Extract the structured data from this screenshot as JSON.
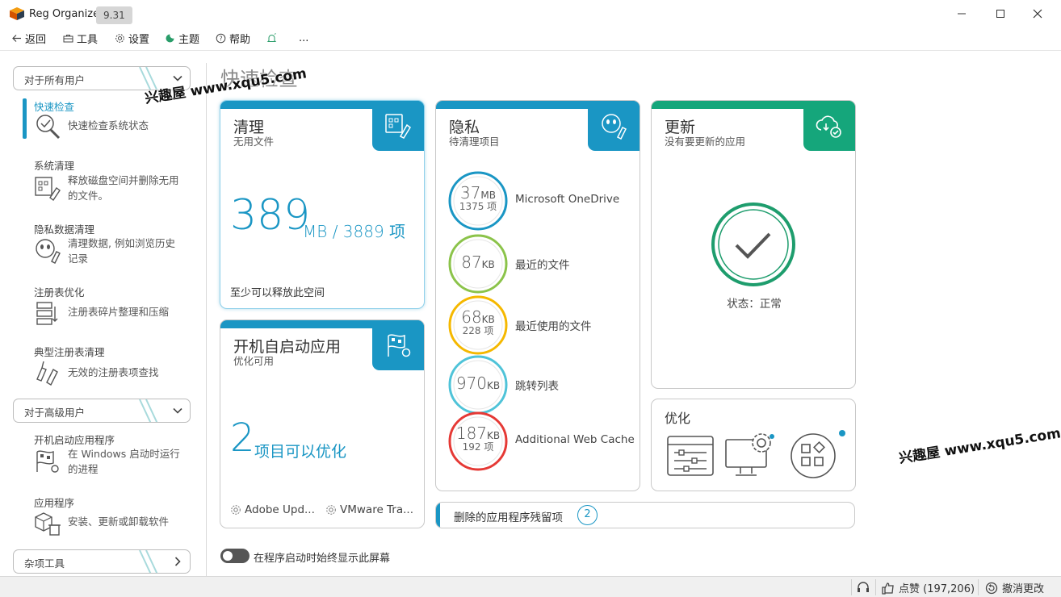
{
  "app": {
    "title": "Reg Organizer",
    "version": "9.31"
  },
  "toolbar": {
    "back": "返回",
    "tools": "工具",
    "settings": "设置",
    "theme": "主题",
    "help": "帮助",
    "more": "..."
  },
  "sidebar": {
    "group_all_users": "对于所有用户",
    "items": [
      {
        "title": "快速检查",
        "desc": "快速检查系统状态"
      },
      {
        "title": "系统清理",
        "desc": "释放磁盘空间并删除无用的文件。"
      },
      {
        "title": "隐私数据清理",
        "desc": "清理数据, 例如浏览历史记录"
      },
      {
        "title": "注册表优化",
        "desc": "注册表碎片整理和压缩"
      },
      {
        "title": "典型注册表清理",
        "desc": "无效的注册表项查找"
      }
    ],
    "group_advanced": "对于高级用户",
    "advanced_items": [
      {
        "title": "开机启动应用程序",
        "desc": "在 Windows 启动时运行的进程"
      },
      {
        "title": "应用程序",
        "desc": "安装、更新或卸载软件"
      }
    ],
    "group_misc": "杂项工具"
  },
  "main": {
    "page_title": "快速检查",
    "cleanup": {
      "title": "清理",
      "subtitle": "无用文件",
      "size_value": "389",
      "size_unit": "MB / 3889 项",
      "footer": "至少可以释放此空间"
    },
    "startup": {
      "title": "开机自启动应用",
      "subtitle": "优化可用",
      "count": "2",
      "count_label": "项目可以优化",
      "apps": [
        "Adobe Upd...",
        "VMware Tra..."
      ]
    },
    "privacy": {
      "title": "隐私",
      "subtitle": "待清理项目",
      "rows": [
        {
          "value": "37",
          "unit": "MB",
          "count": "1375 项",
          "label": "Microsoft OneDrive",
          "color": "#1a96c4"
        },
        {
          "value": "87",
          "unit": "KB",
          "count": "",
          "label": "最近的文件",
          "color": "#8bc34a"
        },
        {
          "value": "68",
          "unit": "KB",
          "count": "228 项",
          "label": "最近使用的文件",
          "color": "#f5b800"
        },
        {
          "value": "970",
          "unit": "KB",
          "count": "",
          "label": "跳转列表",
          "color": "#4fc3d8"
        },
        {
          "value": "187",
          "unit": "KB",
          "count": "192 项",
          "label": "Additional Web Cache",
          "color": "#e53935"
        }
      ]
    },
    "update": {
      "title": "更新",
      "subtitle": "没有要更新的应用",
      "status": "状态：正常"
    },
    "optimize": {
      "title": "优化"
    },
    "leftovers": {
      "label": "删除的应用程序残留项",
      "count": "2"
    },
    "always_show": "在程序启动时始终显示此屏幕"
  },
  "statusbar": {
    "like_label": "点赞 (197,206)",
    "undo_label": "撤消更改"
  },
  "watermarks": [
    "兴趣屋 www.xqu5.com",
    "兴趣屋 www.xqu5.com"
  ],
  "colors": {
    "accent": "#1a96c4",
    "update_green": "#15a67b",
    "ok_ring": "#1e9d6d"
  }
}
